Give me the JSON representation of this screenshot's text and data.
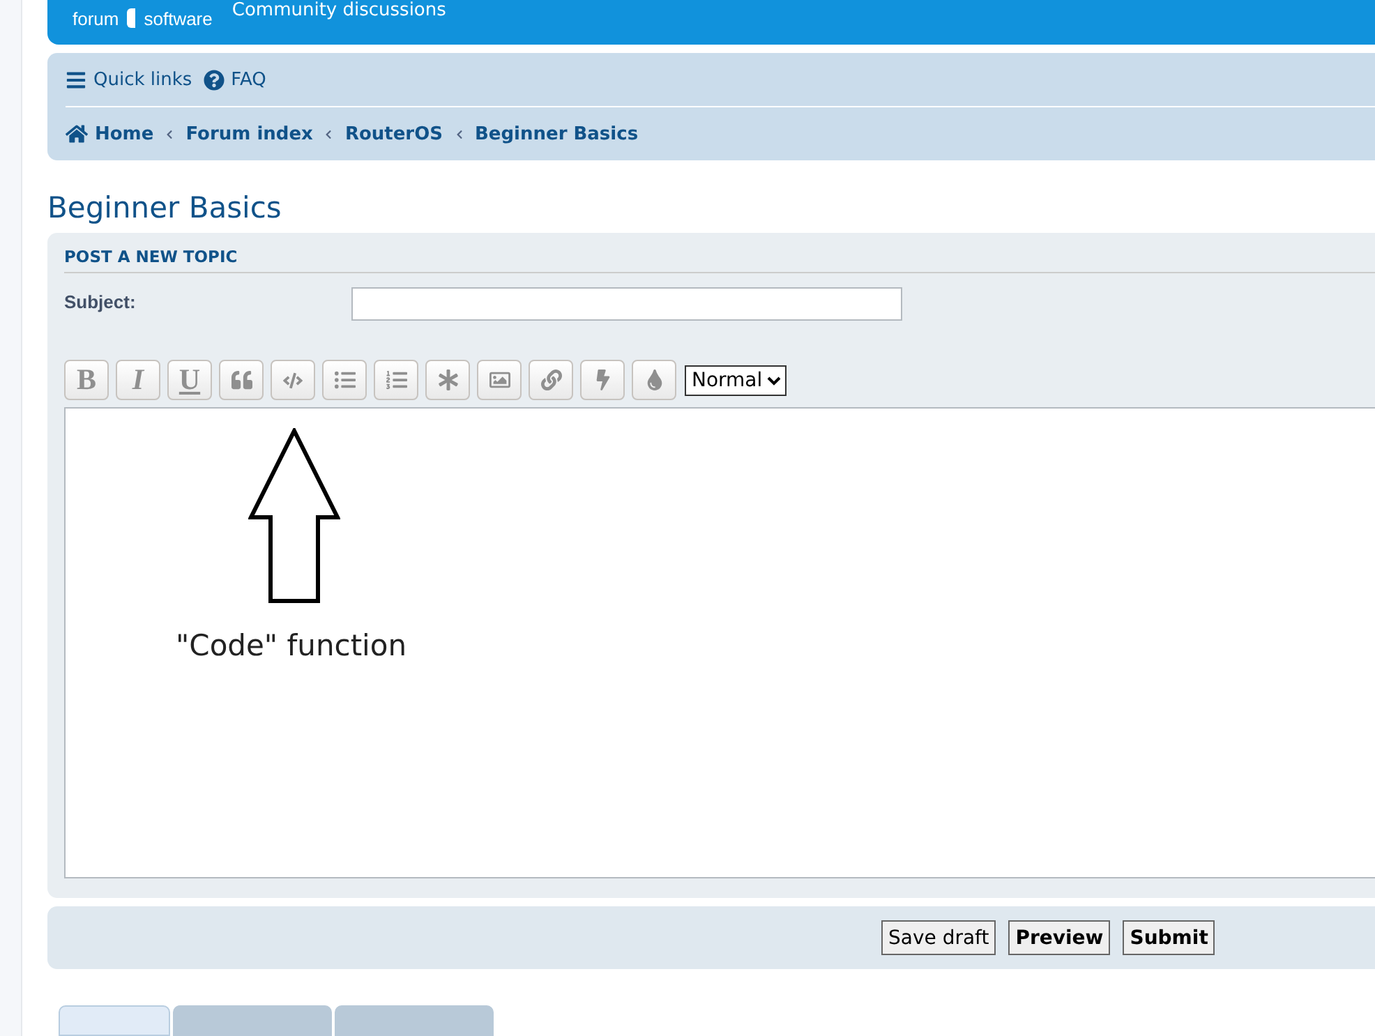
{
  "header": {
    "logo_lines": [
      "forum",
      "software"
    ],
    "tagline": "Community discussions"
  },
  "navbar": {
    "links": [
      {
        "kind": "menu",
        "label": "Quick links"
      },
      {
        "kind": "help",
        "label": "FAQ"
      }
    ],
    "breadcrumbs": [
      {
        "kind": "home",
        "label": "Home"
      },
      {
        "kind": "crumb",
        "label": "Forum index"
      },
      {
        "kind": "crumb",
        "label": "RouterOS"
      },
      {
        "kind": "crumb",
        "label": "Beginner Basics"
      }
    ]
  },
  "page_title": "Beginner Basics",
  "form": {
    "heading": "POST A NEW TOPIC",
    "subject_label": "Subject:",
    "toolbar": [
      {
        "kind": "bold",
        "label": "B"
      },
      {
        "kind": "italic",
        "label": "I"
      },
      {
        "kind": "underline",
        "label": "U"
      },
      {
        "kind": "quote"
      },
      {
        "kind": "code"
      },
      {
        "kind": "list"
      },
      {
        "kind": "ordered-list"
      },
      {
        "kind": "list-item"
      },
      {
        "kind": "image"
      },
      {
        "kind": "link"
      },
      {
        "kind": "flash"
      },
      {
        "kind": "color"
      }
    ],
    "font_size": "Normal",
    "annotation": "\"Code\" function"
  },
  "buttons": [
    {
      "label": "Save draft",
      "bold": false
    },
    {
      "label": "Preview",
      "bold": true
    },
    {
      "label": "Submit",
      "bold": true
    }
  ],
  "tabs": [
    {
      "selected": true
    },
    {
      "selected": false
    },
    {
      "selected": false
    }
  ]
}
